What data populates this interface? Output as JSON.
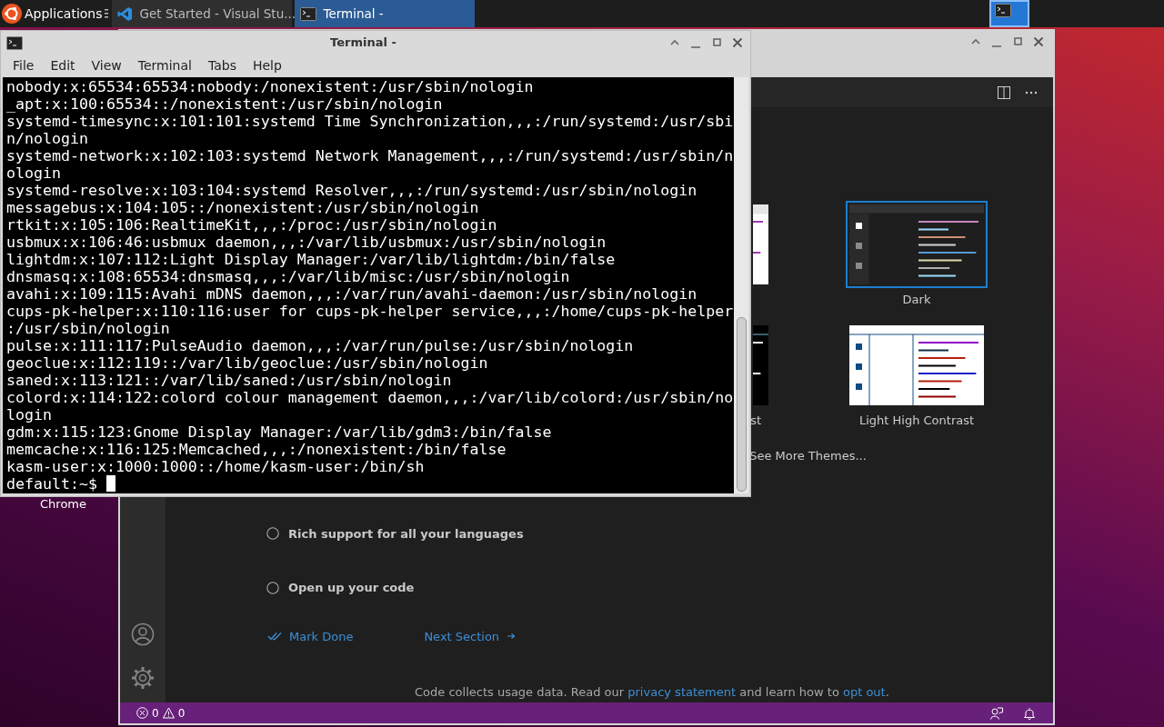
{
  "top_panel": {
    "menu_label": "Applications",
    "tasks": [
      {
        "label": "Get Started - Visual Stu...",
        "kind": "vscode",
        "selected": false
      },
      {
        "label": "Terminal -",
        "kind": "terminal",
        "selected": true
      }
    ]
  },
  "desktop_icons": [
    {
      "label": "Chrome"
    }
  ],
  "vscode": {
    "themes": [
      {
        "kind": "light",
        "selected": false
      },
      {
        "kind": "dark",
        "label": "Dark",
        "selected": true
      },
      {
        "kind": "hc-dark",
        "label": "st",
        "selected": false
      },
      {
        "kind": "hc-light",
        "label": "Light High Contrast",
        "selected": false
      }
    ],
    "see_more": "See More Themes...",
    "steps": [
      {
        "label": "Rich support for all your languages",
        "checked": false
      },
      {
        "label": "Open up your code",
        "checked": false
      }
    ],
    "mark_done": "Mark Done",
    "next_section": "Next Section",
    "footer": [
      {
        "kind": "text",
        "text": "Code collects usage data. Read our "
      },
      {
        "kind": "link",
        "text": "privacy statement"
      },
      {
        "kind": "text",
        "text": " and learn how to "
      },
      {
        "kind": "link",
        "text": "opt out"
      },
      {
        "kind": "text",
        "text": "."
      }
    ],
    "status": {
      "errors": "0",
      "warnings": "0"
    }
  },
  "terminal": {
    "title": "Terminal -",
    "menu": [
      "File",
      "Edit",
      "View",
      "Terminal",
      "Tabs",
      "Help"
    ],
    "lines": [
      "nobody:x:65534:65534:nobody:/nonexistent:/usr/sbin/nologin",
      "_apt:x:100:65534::/nonexistent:/usr/sbin/nologin",
      "systemd-timesync:x:101:101:systemd Time Synchronization,,,:/run/systemd:/usr/sbi",
      "n/nologin",
      "systemd-network:x:102:103:systemd Network Management,,,:/run/systemd:/usr/sbin/n",
      "ologin",
      "systemd-resolve:x:103:104:systemd Resolver,,,:/run/systemd:/usr/sbin/nologin",
      "messagebus:x:104:105::/nonexistent:/usr/sbin/nologin",
      "rtkit:x:105:106:RealtimeKit,,,:/proc:/usr/sbin/nologin",
      "usbmux:x:106:46:usbmux daemon,,,:/var/lib/usbmux:/usr/sbin/nologin",
      "lightdm:x:107:112:Light Display Manager:/var/lib/lightdm:/bin/false",
      "dnsmasq:x:108:65534:dnsmasq,,,:/var/lib/misc:/usr/sbin/nologin",
      "avahi:x:109:115:Avahi mDNS daemon,,,:/var/run/avahi-daemon:/usr/sbin/nologin",
      "cups-pk-helper:x:110:116:user for cups-pk-helper service,,,:/home/cups-pk-helper",
      ":/usr/sbin/nologin",
      "pulse:x:111:117:PulseAudio daemon,,,:/var/run/pulse:/usr/sbin/nologin",
      "geoclue:x:112:119::/var/lib/geoclue:/usr/sbin/nologin",
      "saned:x:113:121::/var/lib/saned:/usr/sbin/nologin",
      "colord:x:114:122:colord colour management daemon,,,:/var/lib/colord:/usr/sbin/no",
      "login",
      "gdm:x:115:123:Gnome Display Manager:/var/lib/gdm3:/bin/false",
      "memcache:x:116:125:Memcached,,,:/nonexistent:/bin/false",
      "kasm-user:x:1000:1000::/home/kasm-user:/bin/sh"
    ],
    "prompt": "default:~$"
  }
}
